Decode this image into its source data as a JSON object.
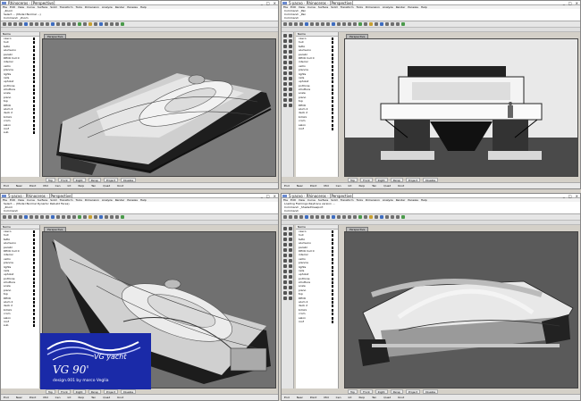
{
  "windows": [
    {
      "title": "Rhinoceros - [Perspective]",
      "menu": [
        "File",
        "Edit",
        "View",
        "Curve",
        "Surface",
        "Solid",
        "Transform",
        "Tools",
        "Dimension",
        "Analyze",
        "Render",
        "Paneles",
        "Help"
      ],
      "cmd_history": [
        "_Zoom",
        "Select ... (Mode=Normal ...)",
        "Select an object ...",
        "Command: _Zoom"
      ],
      "viewport_label": "Perspective",
      "viewtabs": [
        "Top",
        "Front",
        "Right",
        "Persp",
        "Project",
        "Disable"
      ],
      "status": [
        "End",
        "Near",
        "Point",
        "Mid",
        "Cen",
        "Int",
        "Perp",
        "Tan",
        "Quad",
        "Knot"
      ]
    },
    {
      "title": "5-yacvo - Rhinoceros - [Perspective]",
      "menu": [
        "File",
        "Edit",
        "View",
        "Curve",
        "Surface",
        "Solid",
        "Transform",
        "Tools",
        "Dimension",
        "Analyze",
        "Render",
        "Paneles",
        "Help"
      ],
      "cmd_history": [
        "Command: _Pan",
        "Command: _Pan",
        "Command:"
      ],
      "viewport_label": "Perspective",
      "viewtabs": [
        "Top",
        "Front",
        "Right",
        "Persp",
        "Project",
        "Disable"
      ],
      "status": [
        "End",
        "Near",
        "Point",
        "Mid",
        "Cen",
        "Int",
        "Perp",
        "Tan",
        "Quad",
        "Knot"
      ]
    },
    {
      "title": "5-yacvo - Rhinoceros - [Perspective]",
      "menu": [
        "File",
        "Edit",
        "View",
        "Curve",
        "Surface",
        "Solid",
        "Transform",
        "Tools",
        "Dimension",
        "Analyze",
        "Render",
        "Paneles",
        "Help"
      ],
      "cmd_history": [
        "Select ... (Mode=Normal Dynamic Rebuild Faces)",
        "_Zoom",
        "Command:"
      ],
      "viewport_label": "Perspective",
      "viewtabs": [
        "Top",
        "Front",
        "Right",
        "Persp",
        "Project",
        "Disable"
      ],
      "status": [
        "End",
        "Near",
        "Point",
        "Mid",
        "Cen",
        "Int",
        "Perp",
        "Tan",
        "Quad",
        "Knot"
      ]
    },
    {
      "title": "5-yacvo - Rhinoceros - [Perspective]",
      "menu": [
        "File",
        "Edit",
        "View",
        "Curve",
        "Surface",
        "Solid",
        "Transform",
        "Tools",
        "Dimension",
        "Analyze",
        "Render",
        "Paneles",
        "Help"
      ],
      "cmd_history": [
        "Loading Flamingo Raytrace version ...",
        "Command: _ShadedViewport",
        "Command:"
      ],
      "viewport_label": "Perspective",
      "viewtabs": [
        "Top",
        "Front",
        "Right",
        "Persp",
        "Project",
        "Disable"
      ],
      "status": [
        "End",
        "Near",
        "Point",
        "Mid",
        "Cen",
        "Int",
        "Perp",
        "Tan",
        "Quad",
        "Knot"
      ]
    }
  ],
  "layers": [
    "Name",
    "casco",
    "hull",
    "tetto",
    "alumunio",
    "parabr",
    "DECK hull 0",
    "interior",
    "vetro",
    "plancia",
    "lights",
    "rails",
    "upholst",
    "poltrone",
    "strutture",
    "scale",
    "piano",
    "top",
    "DECK",
    "alum 2",
    "deck 2",
    "bimini",
    "crom",
    "salon",
    "roof",
    "sub"
  ],
  "logo": {
    "name": "VG 90'",
    "brand": "VG yacht",
    "credit": "design.001 by marco Veglia",
    "bg": "#1a2aa8"
  }
}
